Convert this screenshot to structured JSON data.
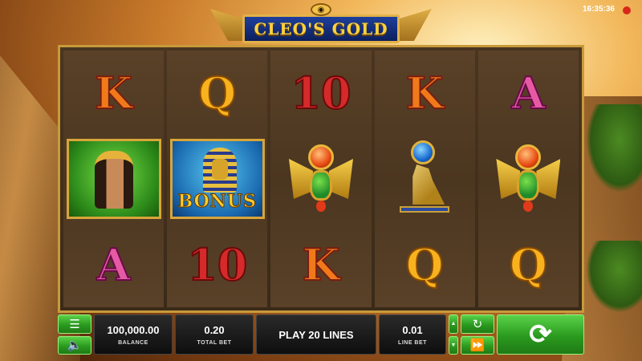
{
  "clock": {
    "time": "16:35:36"
  },
  "logo": {
    "title": "CLEO'S GOLD",
    "icon": "eye-of-horus-icon"
  },
  "reels": [
    [
      "K",
      "cleopatra",
      "A"
    ],
    [
      "Q",
      "bonus",
      "10"
    ],
    [
      "10",
      "scarab",
      "K"
    ],
    [
      "K",
      "falcon",
      "Q"
    ],
    [
      "A",
      "scarab",
      "Q"
    ]
  ],
  "symbols": {
    "bonus_label": "BONUS"
  },
  "controls": {
    "menu_icon": "menu-icon",
    "sound_icon": "speaker-icon",
    "balance": {
      "value": "100,000.00",
      "label": "BALANCE"
    },
    "total_bet": {
      "value": "0.20",
      "label": "TOTAL BET"
    },
    "lines": {
      "label": "PLAY 20 LINES"
    },
    "line_bet": {
      "value": "0.01",
      "label": "LINE BET"
    },
    "autoplay_icon": "autoplay-icon",
    "fast_forward_icon": "fast-forward-icon",
    "spin_icon": "spin-icon"
  },
  "colors": {
    "accent": "#2a9a1e",
    "frame": "#c79a3a",
    "logo_blue": "#1e3f9c",
    "logo_text": "#ffd23a"
  }
}
